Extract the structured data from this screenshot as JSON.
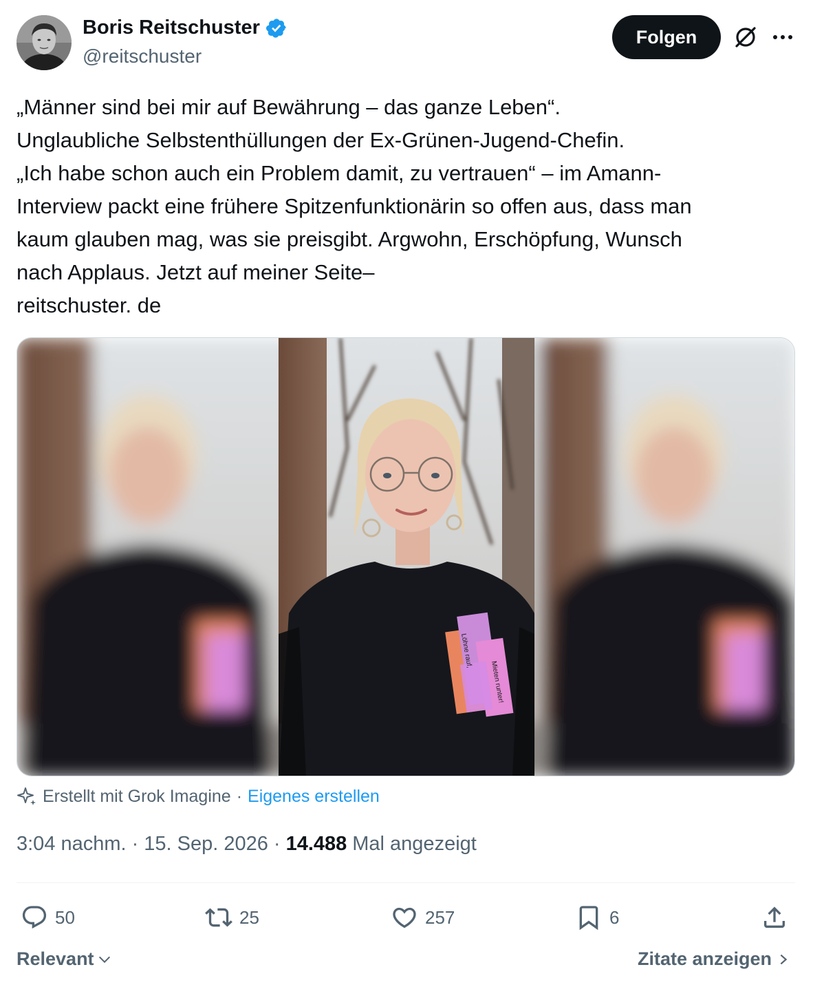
{
  "author": {
    "display_name": "Boris Reitschuster",
    "handle": "@reitschuster",
    "verified_badge_icon": "verified-badge-icon"
  },
  "header": {
    "follow_label": "Folgen",
    "grok_icon": "grok-icon",
    "more_icon": "more-icon"
  },
  "tweet": {
    "lines": [
      "„Männer sind bei mir auf Bewährung – das ganze Leben“.",
      "Unglaubliche Selbstenthüllungen der Ex-Grünen-Jugend-Chefin.",
      "„Ich habe schon auch ein Problem damit, zu vertrauen“ – im Amann-",
      "Interview packt eine frühere Spitzenfunktionärin so offen aus, dass man",
      "kaum glauben mag, was sie preisgibt. Argwohn, Erschöpfung, Wunsch",
      "nach Applaus. Jetzt auf meiner Seite–",
      "reitschuster. de"
    ]
  },
  "media": {
    "shirt_text_1": "Löhne rauf,",
    "shirt_text_2": "Mieten runter!"
  },
  "grok_note": {
    "created_with": "Erstellt mit Grok Imagine",
    "separator": "·",
    "create_own": "Eigenes erstellen"
  },
  "meta": {
    "time": "3:04 nachm.",
    "separator": "·",
    "date": "15. Sep. 2026",
    "views": "14.488",
    "views_label": "Mal angezeigt"
  },
  "actions": {
    "replies": "50",
    "reposts": "25",
    "likes": "257",
    "bookmarks": "6"
  },
  "footer": {
    "sort_label": "Relevant",
    "quotes_label": "Zitate anzeigen"
  },
  "colors": {
    "accent": "#1d9bf0",
    "text": "#0f1419",
    "muted": "#536471"
  }
}
